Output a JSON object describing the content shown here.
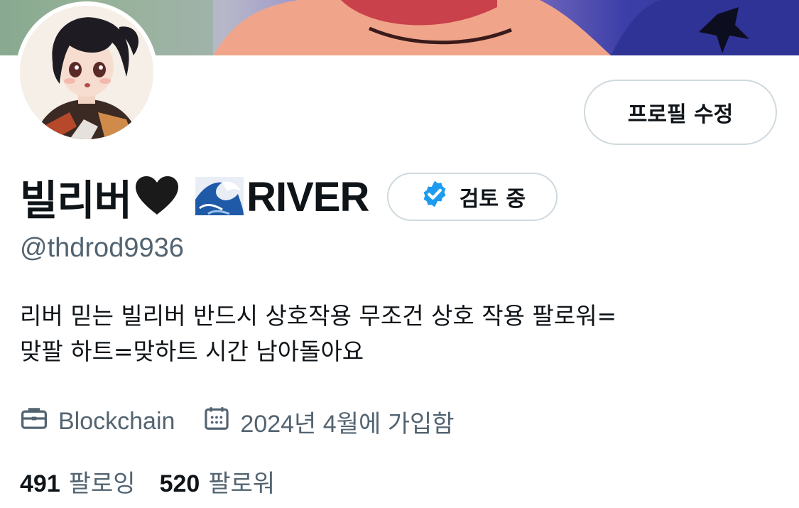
{
  "profile": {
    "edit_button_label": "프로필 수정",
    "display_name": "빌리버",
    "display_name_suffix": "RIVER",
    "verification_badge_label": "검토 중",
    "handle": "@thdrod9936",
    "bio_lines": [
      "리버 믿는 빌리버 반드시 상호작용 무조건 상호 작용 팔로워=",
      "맞팔 하트=맞하트 시간 남아돌아요"
    ],
    "category": "Blockchain",
    "joined": "2024년 4월에 가입함",
    "following_count": "491",
    "following_label": "팔로잉",
    "followers_count": "520",
    "followers_label": "팔로워"
  },
  "icons": {
    "heart": "black-heart-emoji",
    "wave": "water-wave-emoji",
    "verified": "verified-check-icon",
    "category": "briefcase-icon",
    "joined": "calendar-icon"
  },
  "colors": {
    "primary_text": "#0f1419",
    "secondary_text": "#536471",
    "border": "#cfd9de",
    "verified_blue": "#1d9bf0"
  }
}
